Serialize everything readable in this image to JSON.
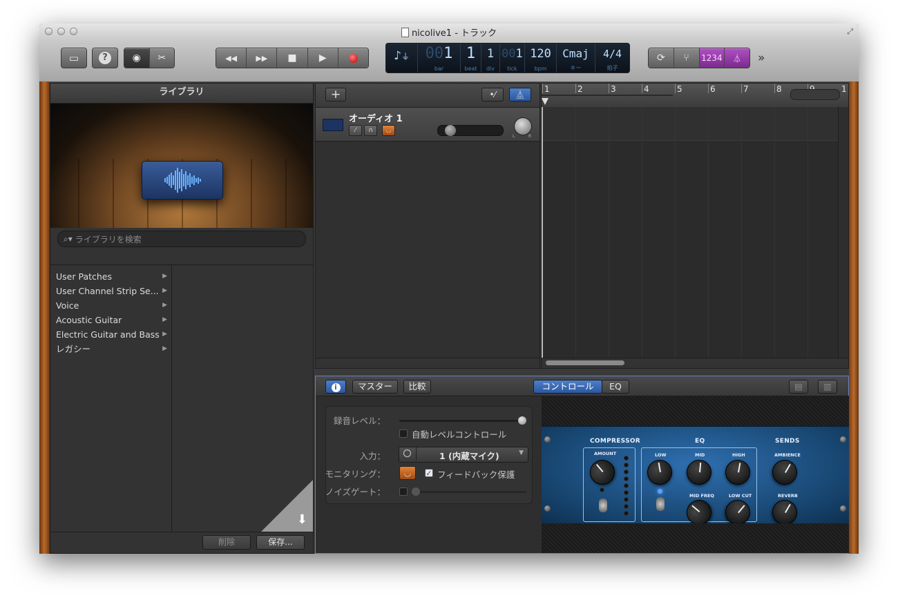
{
  "window": {
    "title": "nicolive1 - トラック"
  },
  "toolbar": {
    "library_icon": "library-icon",
    "help_label": "?",
    "transport": {
      "rewind": "◀◀",
      "forward": "▶▶",
      "stop": "■",
      "play": "▶"
    },
    "lcd": {
      "bar_value": "1",
      "bar_dim": "00",
      "bar_label": "bar",
      "beat_value": "1",
      "beat_label": "beat",
      "div_value": "1",
      "div_label": "div",
      "tick_value": "1",
      "tick_dim": "00",
      "tick_label": "tick",
      "bpm_value": "120",
      "bpm_label": "bpm",
      "key_value": "Cmaj",
      "key_label": "キー",
      "sig_value": "4/4",
      "sig_label": "拍子"
    },
    "countin_label": "1234",
    "more_label": "»"
  },
  "library": {
    "title": "ライブラリ",
    "search_placeholder": "ライブラリを検索",
    "items": [
      {
        "label": "User Patches"
      },
      {
        "label": "User Channel Strip Se..."
      },
      {
        "label": "Voice"
      },
      {
        "label": "Acoustic Guitar"
      },
      {
        "label": "Electric Guitar and Bass"
      },
      {
        "label": "レガシー"
      }
    ],
    "delete_label": "削除",
    "save_label": "保存..."
  },
  "tracks": {
    "add_label": "+",
    "track_name": "オーディオ 1",
    "pan_l": "L",
    "pan_r": "R"
  },
  "ruler": {
    "bars": [
      "1",
      "2",
      "3",
      "4",
      "5",
      "6",
      "7",
      "8",
      "9",
      "1"
    ]
  },
  "editor": {
    "info_label": "i",
    "master_label": "マスター",
    "compare_label": "比較",
    "controls_tab": "コントロール",
    "eq_tab": "EQ",
    "rec_level_label": "録音レベル：",
    "auto_level_label": "自動レベルコントロール",
    "input_label": "入力：",
    "input_value": "1 (内蔵マイク)",
    "monitoring_label": "モニタリング：",
    "feedback_label": "フィードバック保護",
    "noise_gate_label": "ノイズゲート："
  },
  "amp": {
    "compressor": "COMPRESSOR",
    "amount": "AMOUNT",
    "eq": "EQ",
    "low": "LOW",
    "mid": "MID",
    "high": "HIGH",
    "mid_freq": "MID FREQ",
    "low_cut": "LOW CUT",
    "sends": "SENDS",
    "ambience": "AMBIENCE",
    "reverb": "REVERB"
  }
}
